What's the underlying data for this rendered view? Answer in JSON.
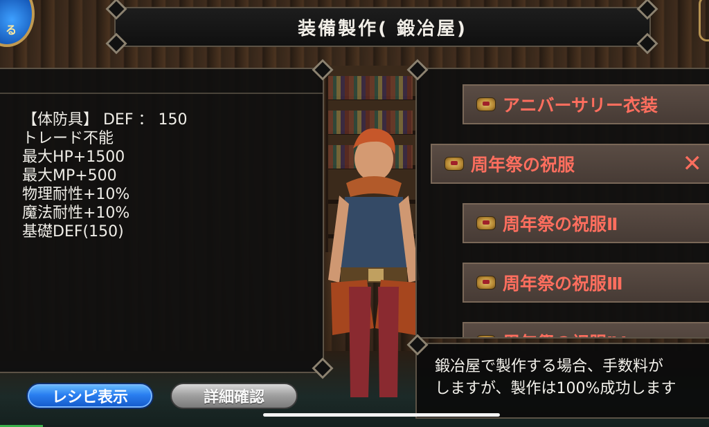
{
  "title": "装備製作( 鍛冶屋)",
  "emblem_text": "る",
  "stats": [
    "【体防具】 DEF ： 150",
    "トレード不能",
    "最大HP+1500",
    "最大MP+500",
    "物理耐性+10%",
    "魔法耐性+10%",
    "基礎DEF(150)"
  ],
  "recipes": [
    {
      "label": "アニバーサリー衣装",
      "selected": false
    },
    {
      "label": "周年祭の祝服",
      "selected": true
    },
    {
      "label": "周年祭の祝服Ⅱ",
      "selected": false
    },
    {
      "label": "周年祭の祝服Ⅲ",
      "selected": false
    },
    {
      "label": "周年祭の祝服Ⅳ",
      "selected": false
    }
  ],
  "close_mark": "✕",
  "message": {
    "line1": "鍛冶屋で製作する場合、手数料が",
    "line2": "しますが、製作は100%成功します"
  },
  "buttons": {
    "recipe": "レシピ表示",
    "detail": "詳細確認"
  },
  "colors": {
    "recipe_text": "#ff6e5e",
    "recipe_button": "#2a7ff0",
    "detail_button": "#a2a2a2",
    "panel_border": "#5c5346"
  }
}
